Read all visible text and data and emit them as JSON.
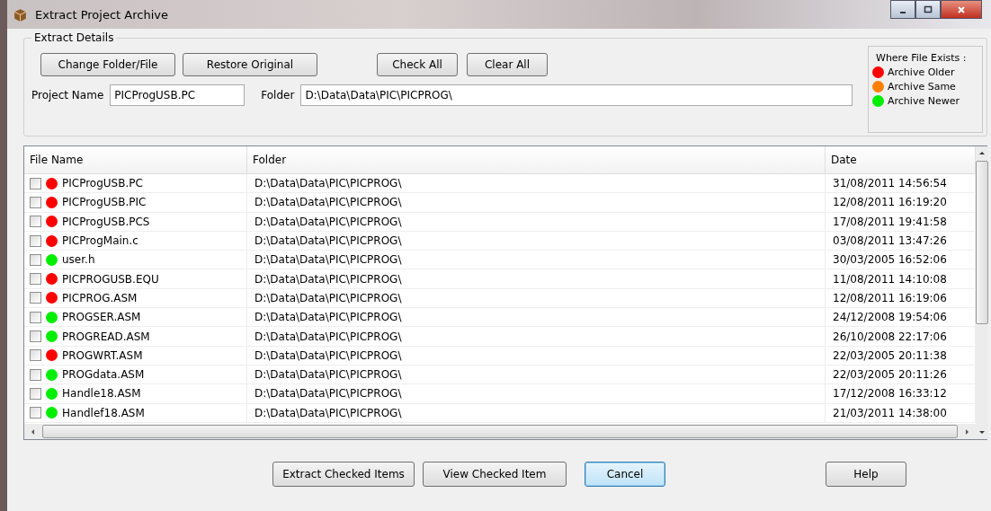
{
  "window": {
    "title": "Extract Project Archive"
  },
  "details": {
    "legend": "Extract Details",
    "buttons": [
      "Change Folder/File",
      "Restore Original",
      "Check All",
      "Clear All"
    ],
    "project_name_label": "Project Name",
    "project_name": "PICProgUSB.PC",
    "folder_label": "Folder",
    "folder": "D:\\Data\\Data\\PIC\\PICPROG\\"
  },
  "key": {
    "title": "Where File Exists :",
    "items": [
      {
        "label": "Archive Older",
        "color": "#ff0000"
      },
      {
        "label": "Archive Same",
        "color": "#ff8000"
      },
      {
        "label": "Archive Newer",
        "color": "#00ee00"
      }
    ]
  },
  "table": {
    "columns": [
      "File Name",
      "Folder",
      "Date"
    ],
    "rows": [
      {
        "checked": false,
        "color": "#ff0000",
        "name": "PICProgUSB.PC",
        "folder": "D:\\Data\\Data\\PIC\\PICPROG\\",
        "date": "31/08/2011 14:56:54"
      },
      {
        "checked": false,
        "color": "#ff0000",
        "name": "PICProgUSB.PIC",
        "folder": "D:\\Data\\Data\\PIC\\PICPROG\\",
        "date": "12/08/2011 16:19:20"
      },
      {
        "checked": false,
        "color": "#ff0000",
        "name": "PICProgUSB.PCS",
        "folder": "D:\\Data\\Data\\PIC\\PICPROG\\",
        "date": "17/08/2011 19:41:58"
      },
      {
        "checked": false,
        "color": "#ff0000",
        "name": "PICProgMain.c",
        "folder": "D:\\Data\\Data\\PIC\\PICPROG\\",
        "date": "03/08/2011 13:47:26"
      },
      {
        "checked": false,
        "color": "#00ee00",
        "name": "user.h",
        "folder": "D:\\Data\\Data\\PIC\\PICPROG\\",
        "date": "30/03/2005 16:52:06"
      },
      {
        "checked": false,
        "color": "#ff0000",
        "name": "PICPROGUSB.EQU",
        "folder": "D:\\Data\\Data\\PIC\\PICPROG\\",
        "date": "11/08/2011 14:10:08"
      },
      {
        "checked": false,
        "color": "#ff0000",
        "name": "PICPROG.ASM",
        "folder": "D:\\Data\\Data\\PIC\\PICPROG\\",
        "date": "12/08/2011 16:19:06"
      },
      {
        "checked": false,
        "color": "#00ee00",
        "name": "PROGSER.ASM",
        "folder": "D:\\Data\\Data\\PIC\\PICPROG\\",
        "date": "24/12/2008 19:54:06"
      },
      {
        "checked": false,
        "color": "#00ee00",
        "name": "PROGREAD.ASM",
        "folder": "D:\\Data\\Data\\PIC\\PICPROG\\",
        "date": "26/10/2008 22:17:06"
      },
      {
        "checked": false,
        "color": "#ff0000",
        "name": "PROGWRT.ASM",
        "folder": "D:\\Data\\Data\\PIC\\PICPROG\\",
        "date": "22/03/2005 20:11:38"
      },
      {
        "checked": false,
        "color": "#00ee00",
        "name": "PROGdata.ASM",
        "folder": "D:\\Data\\Data\\PIC\\PICPROG\\",
        "date": "22/03/2005 20:11:26"
      },
      {
        "checked": false,
        "color": "#00ee00",
        "name": "Handle18.ASM",
        "folder": "D:\\Data\\Data\\PIC\\PICPROG\\",
        "date": "17/12/2008 16:33:12"
      },
      {
        "checked": false,
        "color": "#00ee00",
        "name": "Handlef18.ASM",
        "folder": "D:\\Data\\Data\\PIC\\PICPROG\\",
        "date": "21/03/2011 14:38:00"
      }
    ]
  },
  "footer": {
    "buttons": [
      {
        "label": "Extract Checked Items",
        "selected": false
      },
      {
        "label": "View Checked Item",
        "selected": false
      },
      {
        "label": "Cancel",
        "selected": true
      },
      {
        "label": "Help",
        "selected": false
      }
    ]
  }
}
